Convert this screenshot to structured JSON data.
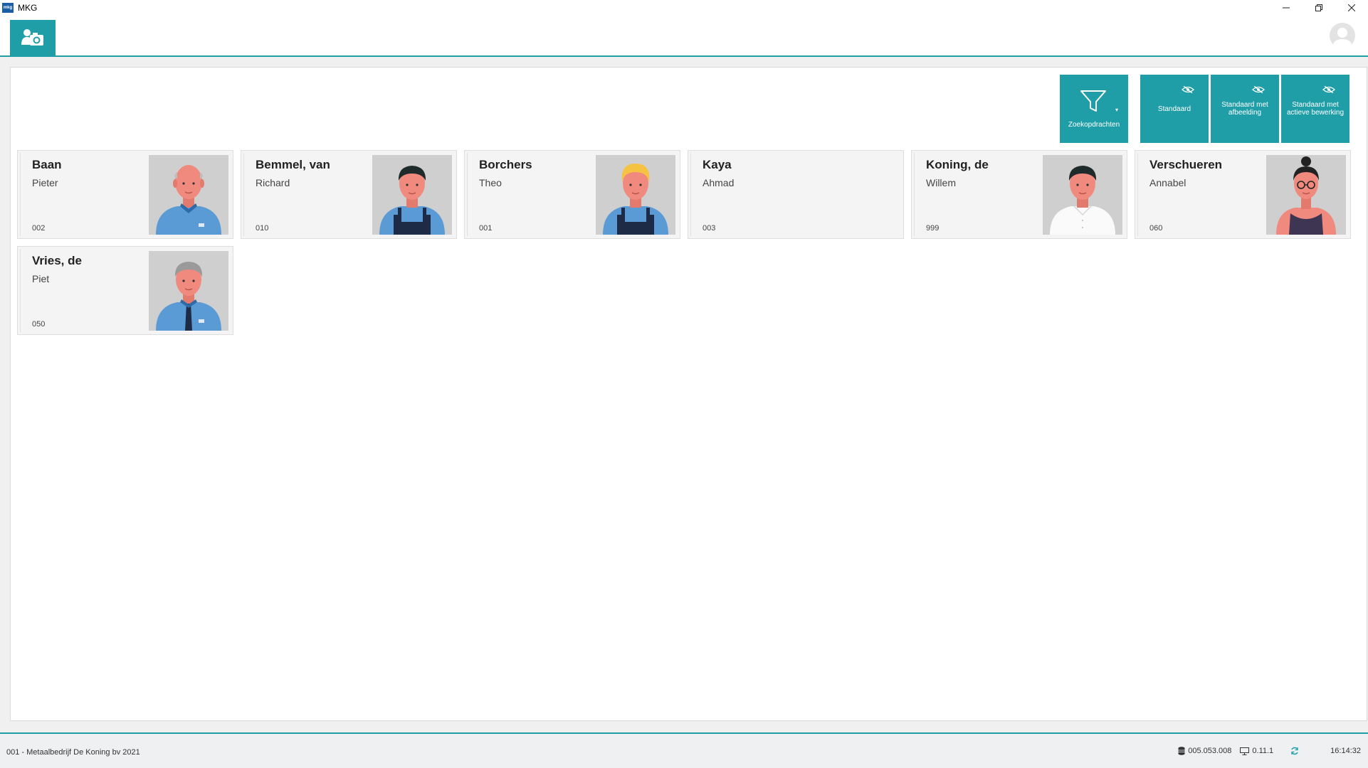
{
  "window": {
    "logo_text": "mkg",
    "title": "MKG",
    "minimize": "—",
    "restore": "❐",
    "close": "✕"
  },
  "toolbar": {
    "search_label": "Zoekopdrachten",
    "views": [
      {
        "label": "Standaard"
      },
      {
        "label": "Standaard met afbeelding"
      },
      {
        "label": "Standaard met actieve bewerking"
      }
    ]
  },
  "cards": [
    {
      "last": "Baan",
      "first": "Pieter",
      "code": "002",
      "photo": "bald-man-blue-shirt"
    },
    {
      "last": "Bemmel, van",
      "first": "Richard",
      "code": "010",
      "photo": "dark-hair-man-overalls"
    },
    {
      "last": "Borchers",
      "first": "Theo",
      "code": "001",
      "photo": "blond-man-overalls"
    },
    {
      "last": "Kaya",
      "first": "Ahmad",
      "code": "003",
      "photo": ""
    },
    {
      "last": "Koning, de",
      "first": "Willem",
      "code": "999",
      "photo": "dark-hair-man-white-shirt"
    },
    {
      "last": "Verschueren",
      "first": "Annabel",
      "code": "060",
      "photo": "woman-glasses-bun"
    },
    {
      "last": "Vries, de",
      "first": "Piet",
      "code": "050",
      "photo": "gray-hair-man-tie"
    }
  ],
  "status": {
    "company": "001 - Metaalbedrijf De Koning bv   2021",
    "db_version": "005.053.008",
    "client_version": "0.11.1",
    "time": "16:14:32"
  },
  "colors": {
    "accent": "#1f9ea8",
    "skin": "#f08a7e",
    "blue_shirt": "#5b9bd5",
    "overalls": "#1d2b46"
  }
}
